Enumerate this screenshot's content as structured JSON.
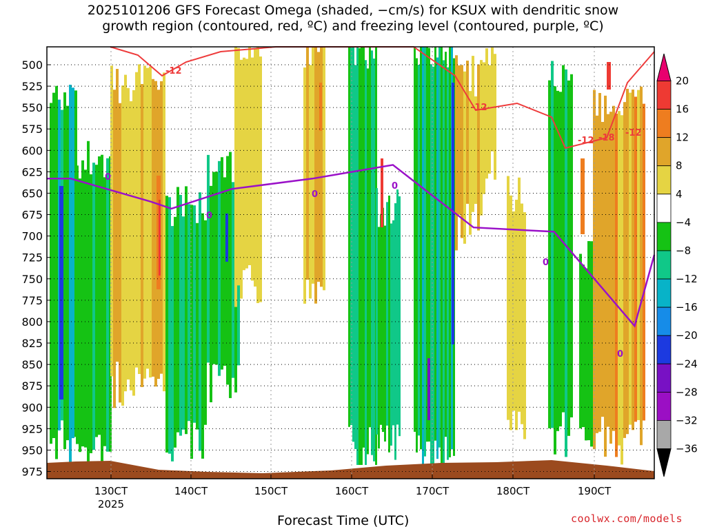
{
  "title": "2025101206 GFS Forecast Omega (shaded, −cm/s) for KSUX with dendritic snow\ngrowth region (contoured, red, ºC) and freezing level (contoured, purple, ºC)",
  "credit": "coolwx.com/models",
  "chart_data": {
    "type": "heatmap",
    "title": "2025101206 GFS Forecast Omega (shaded, −cm/s) for KSUX with dendritic snow growth region (contoured, red, ºC) and freezing level (contoured, purple, ºC)",
    "xlabel": "Forecast Time (UTC)",
    "ylabel": "",
    "x_ticks": [
      "130CT",
      "140CT",
      "150CT",
      "160CT",
      "170CT",
      "180CT",
      "190CT"
    ],
    "x_tick_sublabel": "2025",
    "y_ticks": [
      500,
      525,
      550,
      575,
      600,
      625,
      650,
      675,
      700,
      725,
      750,
      775,
      800,
      825,
      850,
      875,
      900,
      925,
      950,
      975
    ],
    "y_axis": "pressure (hPa), increasing downward",
    "grid": true,
    "colorbar": {
      "labels": [
        20,
        16,
        12,
        8,
        4,
        -4,
        -8,
        -12,
        -16,
        -20,
        -24,
        -28,
        -32,
        -36
      ],
      "colors": [
        "#e8006e",
        "#ee3a33",
        "#ee7d1f",
        "#e0a52a",
        "#e5d443",
        "#ffffff",
        "#15c214",
        "#10c888",
        "#08b3c8",
        "#168ce8",
        "#1c3ae0",
        "#7811c4",
        "#9b0fc4",
        "#a8a8a8",
        "#000000"
      ]
    },
    "contours": [
      {
        "name": "dendritic snow growth region",
        "color": "#ee3b3b",
        "labels": [
          "-12",
          "-12",
          "-12",
          "-18",
          "-12"
        ]
      },
      {
        "name": "freezing level",
        "color": "#9a11c8",
        "labels": [
          "0",
          "0",
          "0",
          "0",
          "0",
          "0",
          "0"
        ]
      }
    ],
    "freezing_level_hpa": [
      {
        "t": "12Z 12 Oct",
        "p": 633
      },
      {
        "t": "12Z 13 Oct",
        "p": 660
      },
      {
        "t": "18Z 13 Oct",
        "p": 668
      },
      {
        "t": "12Z 14 Oct",
        "p": 645
      },
      {
        "t": "12Z 15 Oct",
        "p": 633
      },
      {
        "t": "12Z 16 Oct",
        "p": 617
      },
      {
        "t": "12Z 17 Oct",
        "p": 690
      },
      {
        "t": "12Z 18 Oct",
        "p": 695
      },
      {
        "t": "12Z 19 Oct",
        "p": 805
      },
      {
        "t": "12Z 20 Oct",
        "p": 722
      }
    ]
  }
}
